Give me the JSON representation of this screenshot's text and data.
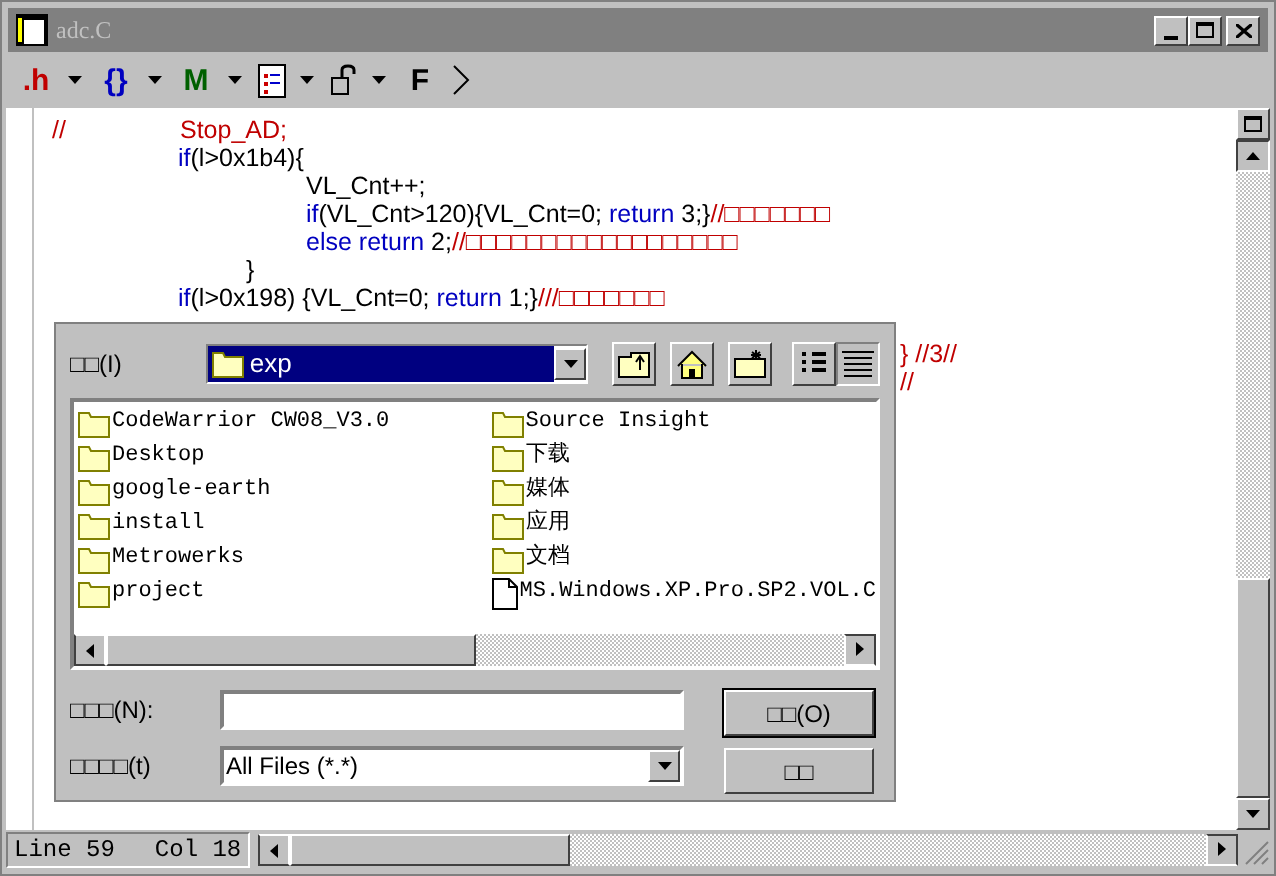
{
  "window": {
    "title": "adc.C"
  },
  "toolbar": [
    {
      "kind": "glyph",
      "glyph": ".h",
      "color": "#c00000"
    },
    {
      "kind": "glyph",
      "glyph": "{}",
      "color": "#0000c0"
    },
    {
      "kind": "glyph",
      "glyph": "M",
      "color": "#006000"
    },
    {
      "kind": "document"
    },
    {
      "kind": "lock"
    },
    {
      "kind": "glyph",
      "glyph": "F",
      "color": "#000000"
    }
  ],
  "code_lines": [
    {
      "kind": "flush",
      "segments": [
        {
          "kind": "comment",
          "text": "//\t\tStop_AD;"
        }
      ]
    },
    {
      "kind": "indent2",
      "segments": [
        {
          "kind": "keyword",
          "text": "if"
        },
        {
          "kind": "plain",
          "text": "(l>0x1b4){"
        }
      ]
    },
    {
      "kind": "indent4",
      "segments": [
        {
          "kind": "plain",
          "text": "VL_Cnt++;"
        }
      ]
    },
    {
      "kind": "indent4",
      "segments": [
        {
          "kind": "keyword",
          "text": "if"
        },
        {
          "kind": "plain",
          "text": "(VL_Cnt>120){VL_Cnt=0; "
        },
        {
          "kind": "keyword",
          "text": "return"
        },
        {
          "kind": "plain",
          "text": " 3;}"
        },
        {
          "kind": "comment",
          "text": "//□□□□□□□"
        }
      ]
    },
    {
      "kind": "indent4",
      "segments": [
        {
          "kind": "keyword",
          "text": "else return"
        },
        {
          "kind": "plain",
          "text": " 2;"
        },
        {
          "kind": "comment",
          "text": "//□□□□□□□□□□□□□□□□□□"
        }
      ]
    },
    {
      "kind": "indent3",
      "segments": [
        {
          "kind": "plain",
          "text": "}"
        }
      ]
    },
    {
      "kind": "indent2",
      "segments": [
        {
          "kind": "keyword",
          "text": "if"
        },
        {
          "kind": "plain",
          "text": "(l>0x198) {VL_Cnt=0; "
        },
        {
          "kind": "keyword",
          "text": "return"
        },
        {
          "kind": "plain",
          "text": " 1;}"
        },
        {
          "kind": "comment",
          "text": "///□□□□□□□"
        }
      ]
    },
    {
      "kind": "covered_after_gap",
      "segments": [
        {
          "kind": "comment",
          "text": "} //3//"
        }
      ]
    },
    {
      "kind": "covered",
      "segments": [
        {
          "kind": "comment",
          "text": "//"
        }
      ]
    }
  ],
  "dialog": {
    "look_in_label": "□□(I)",
    "look_in_value": "exp",
    "tools": [
      {
        "kind": "up"
      },
      {
        "kind": "home"
      },
      {
        "kind": "new-folder"
      },
      {
        "kind": "list",
        "selected": false
      },
      {
        "kind": "details",
        "selected": true
      }
    ],
    "files": [
      {
        "kind": "folder",
        "name": "CodeWarrior CW08_V3.0"
      },
      {
        "kind": "folder",
        "name": "Desktop"
      },
      {
        "kind": "folder",
        "name": "google-earth"
      },
      {
        "kind": "folder",
        "name": "install"
      },
      {
        "kind": "folder",
        "name": "Metrowerks"
      },
      {
        "kind": "folder",
        "name": "project"
      },
      {
        "kind": "folder",
        "name": "Source Insight"
      },
      {
        "kind": "folder",
        "name": "下载"
      },
      {
        "kind": "folder",
        "name": "媒体"
      },
      {
        "kind": "folder",
        "name": "应用"
      },
      {
        "kind": "folder",
        "name": "文档"
      },
      {
        "kind": "file",
        "name": "MS.Windows.XP.Pro.SP2.VOL.C"
      }
    ],
    "file_name_label": "□□□(N):",
    "file_type_label": "□□□□(t)",
    "file_type_value": "All Files (*.*)",
    "buttons": [
      "□□(O)",
      "□□"
    ]
  },
  "status_bar": {
    "line": "Line 59",
    "col": "Col 18"
  }
}
